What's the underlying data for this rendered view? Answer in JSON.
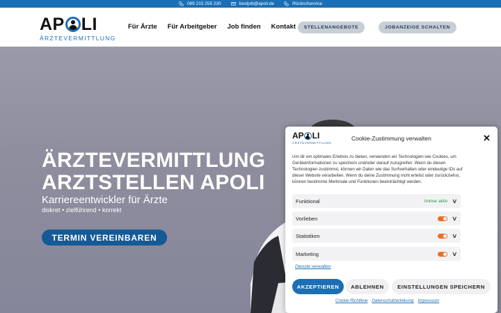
{
  "topbar": {
    "phone": "089 215 255 230",
    "email": "bestjob@apoli.de",
    "callback": "Rückrufservice"
  },
  "logo": {
    "left": "AP",
    "right": "LI",
    "subtitle": "ÄRZTEVERMITTLUNG"
  },
  "nav": {
    "items": [
      "Für Ärzte",
      "Für Arbeitgeber",
      "Job finden",
      "Kontakt"
    ],
    "button_jobs": "STELLENANGEBOTE",
    "button_post": "JOBANZEIGE SCHALTEN"
  },
  "hero": {
    "line1": "ÄRZTEVERMITTLUNG",
    "line2": "ARZTSTELLEN APOLI",
    "subtitle": "Karriereentwickler für Ärzte",
    "tagline": "diskret • zielführend • korrekt",
    "cta": "TERMIN VEREINBAREN"
  },
  "cookie": {
    "title": "Cookie-Zustimmung verwalten",
    "close": "✕",
    "text": "Um dir ein optimales Erlebnis zu bieten, verwenden wir Technologien wie Cookies, um Geräteinformationen zu speichern und/oder darauf zuzugreifen. Wenn du diesen Technologien zustimmst, können wir Daten wie das Surfverhalten oder eindeutige IDs auf dieser Website verarbeiten. Wenn du deine Zustimmung nicht erteilst oder zurückziehst, können bestimmte Merkmale und Funktionen beeinträchtigt werden.",
    "categories": [
      {
        "label": "Funktional",
        "status": "Immer aktiv"
      },
      {
        "label": "Vorlieben",
        "status": ""
      },
      {
        "label": "Statistiken",
        "status": ""
      },
      {
        "label": "Marketing",
        "status": ""
      }
    ],
    "manage": "Dienste verwalten",
    "accept": "AKZEPTIEREN",
    "reject": "ABLEHNEN",
    "save": "EINSTELLUNGEN SPEICHERN",
    "links": [
      "Cookie-Richtlinie",
      "Datenschutzerklärung",
      "Impressum"
    ]
  },
  "colors": {
    "brand_blue": "#1b6fb5",
    "cta_blue": "#145a96",
    "toggle_orange": "#e8702a",
    "always_green": "#1e9b3a"
  }
}
